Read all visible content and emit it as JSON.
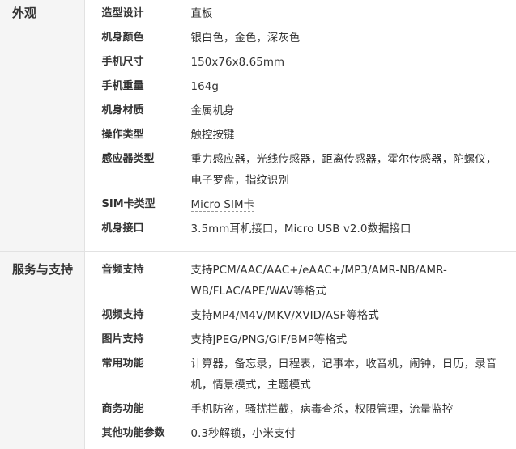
{
  "sections": [
    {
      "category": "外观",
      "rows": [
        {
          "key": "造型设计",
          "value": "直板"
        },
        {
          "key": "机身颜色",
          "value": "银白色，金色，深灰色"
        },
        {
          "key": "手机尺寸",
          "value": "150x76x8.65mm"
        },
        {
          "key": "手机重量",
          "value": "164g"
        },
        {
          "key": "机身材质",
          "value": "金属机身"
        },
        {
          "key": "操作类型",
          "value": "触控按键"
        },
        {
          "key": "感应器类型",
          "value": "重力感应器，光线传感器，距离传感器，霍尔传感器，陀螺仪，电子罗盘，指纹识别"
        },
        {
          "key": "SIM卡类型",
          "value": "Micro SIM卡"
        },
        {
          "key": "机身接口",
          "value": "3.5mm耳机接口，Micro USB v2.0数据接口"
        }
      ]
    },
    {
      "category": "服务与支持",
      "rows": [
        {
          "key": "音频支持",
          "value": "支持PCM/AAC/AAC+/eAAC+/MP3/AMR-NB/AMR-WB/FLAC/APE/WAV等格式"
        },
        {
          "key": "视频支持",
          "value": "支持MP4/M4V/MKV/XVID/ASF等格式"
        },
        {
          "key": "图片支持",
          "value": "支持JPEG/PNG/GIF/BMP等格式"
        },
        {
          "key": "常用功能",
          "value": "计算器，备忘录，日程表，记事本，收音机，闹钟，日历，录音机，情景模式，主题模式"
        },
        {
          "key": "商务功能",
          "value": "手机防盗，骚扰拦截，病毒查杀，权限管理，流量监控"
        },
        {
          "key": "其他功能参数",
          "value": "0.3秒解锁，小米支付"
        }
      ]
    }
  ]
}
